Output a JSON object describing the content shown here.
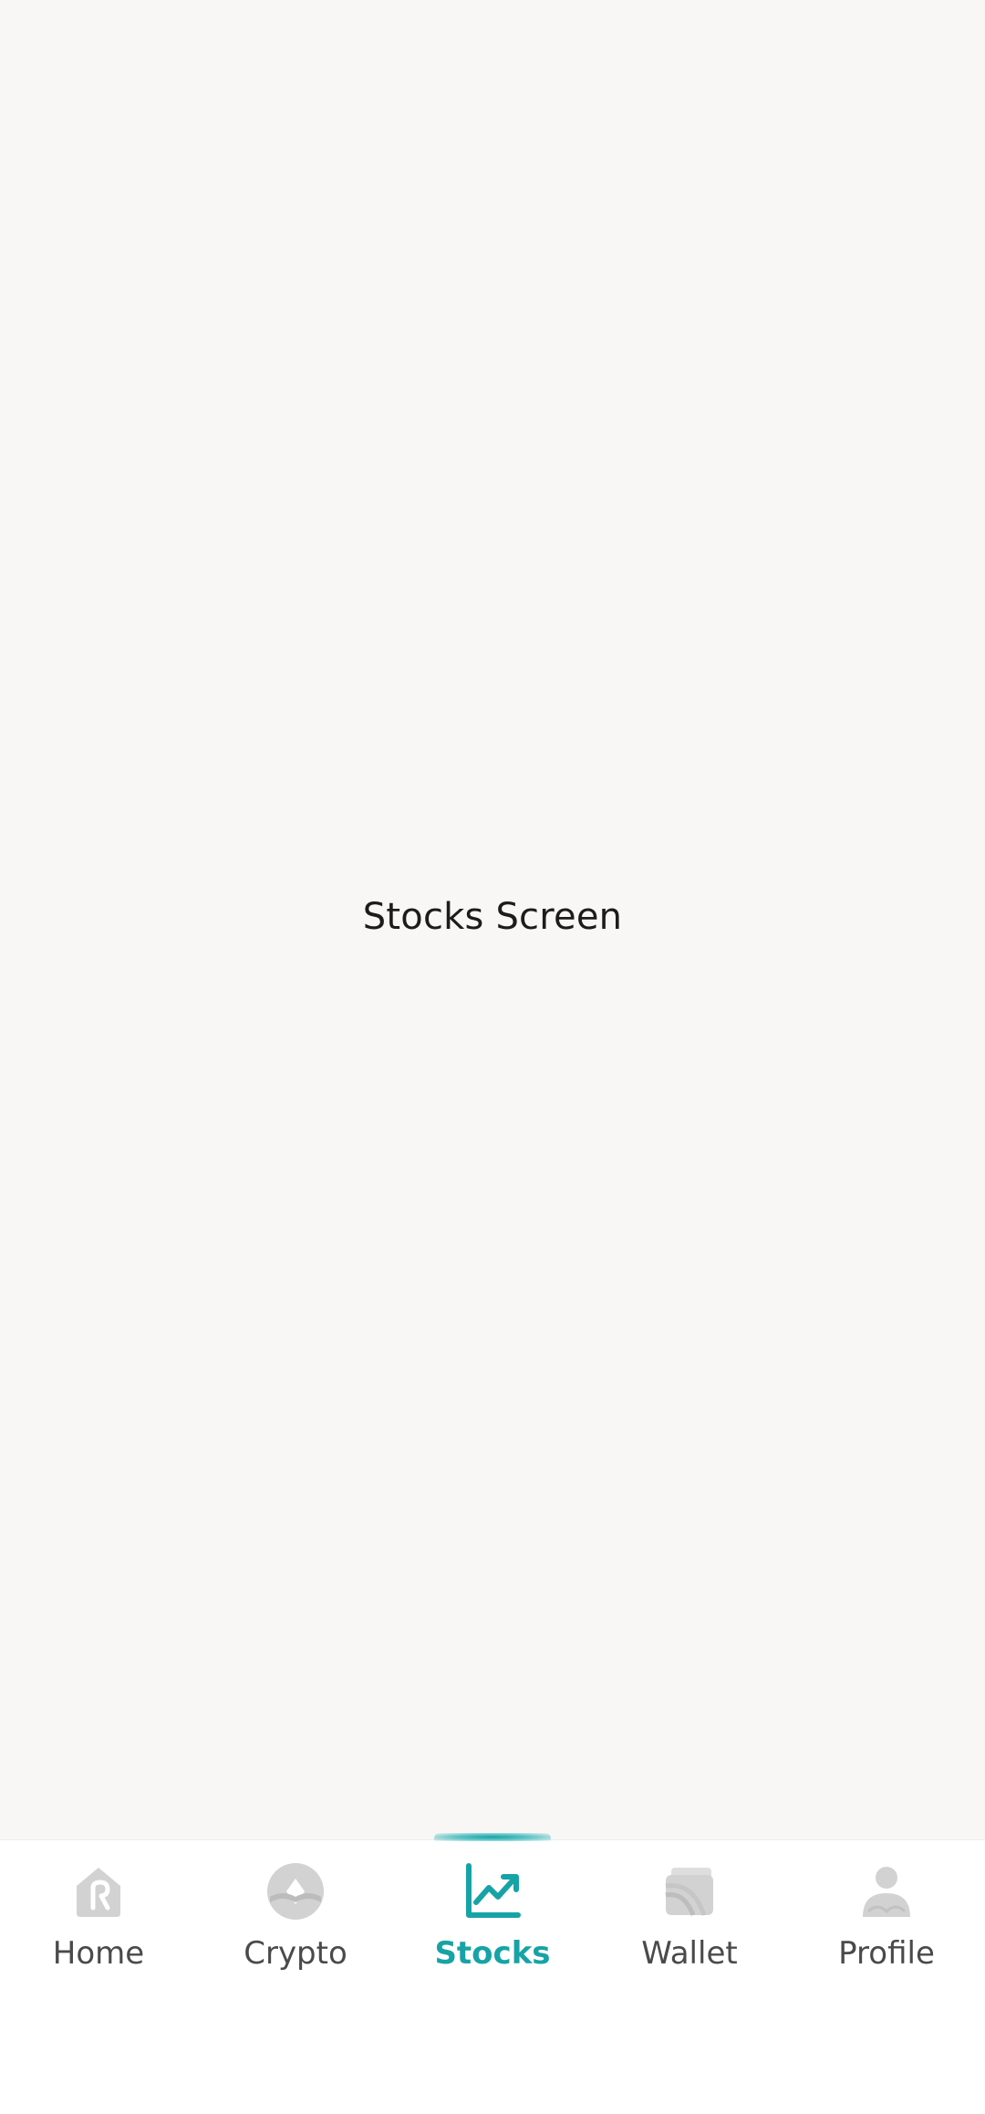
{
  "screen": {
    "title": "Stocks Screen"
  },
  "bottom_nav": {
    "active_index": 2,
    "colors": {
      "active": "#17a3a6",
      "inactive_icon": "#cfcfcf",
      "inactive_label": "#4a4a4a"
    },
    "items": [
      {
        "label": "Home",
        "icon": "home-icon"
      },
      {
        "label": "Crypto",
        "icon": "crypto-icon"
      },
      {
        "label": "Stocks",
        "icon": "stocks-chart-icon"
      },
      {
        "label": "Wallet",
        "icon": "wallet-icon"
      },
      {
        "label": "Profile",
        "icon": "profile-icon"
      }
    ]
  }
}
